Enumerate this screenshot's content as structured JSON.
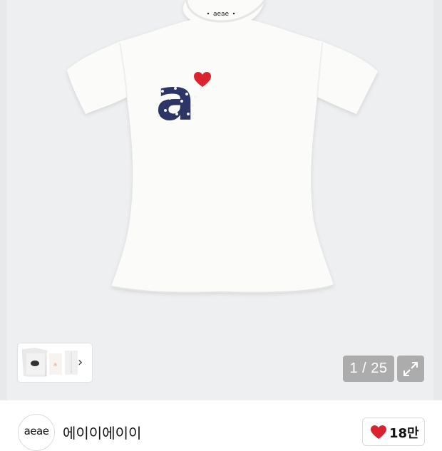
{
  "gallery": {
    "current_index": "1",
    "separator": "/",
    "total": "25",
    "counter_text": "1 / 25",
    "shirt_tag_text": "aeae",
    "shirt_print_letter": "a"
  },
  "brand": {
    "logo_text": "aeae",
    "name": "에이이에이이"
  },
  "like": {
    "count": "18만"
  },
  "colors": {
    "heart": "#d9242f",
    "print_navy": "#2c3566",
    "background": "#eeeff1"
  }
}
